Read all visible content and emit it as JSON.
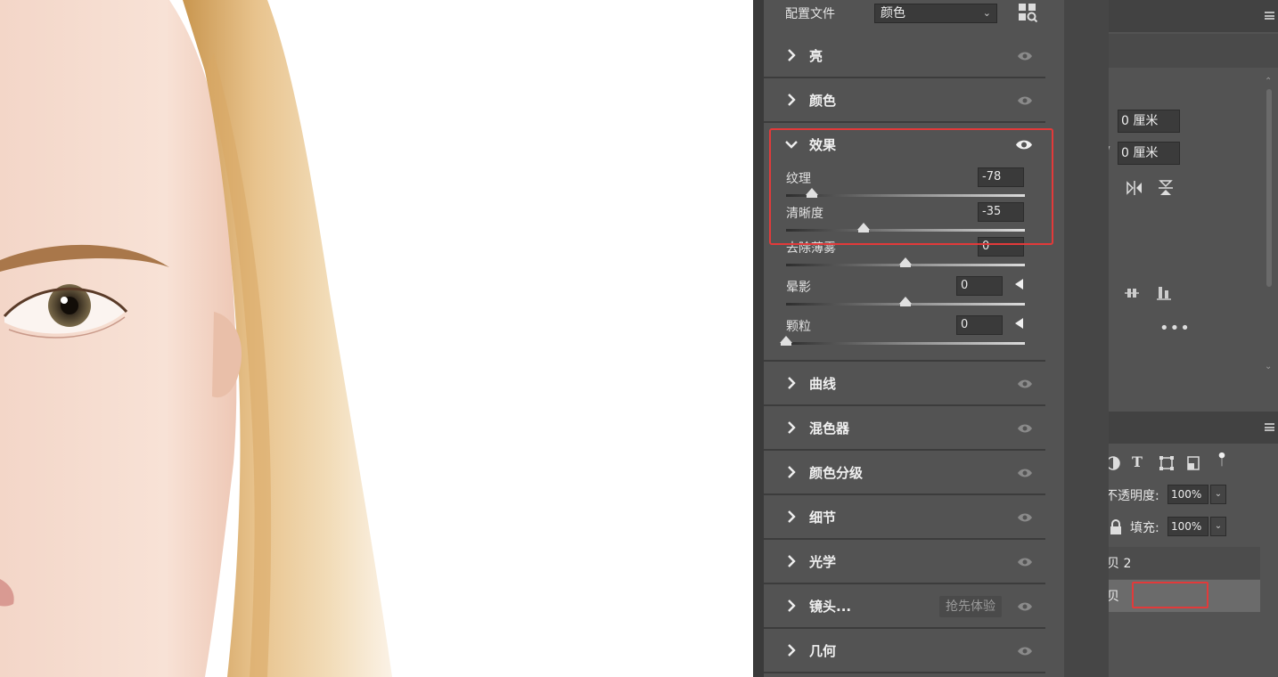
{
  "profile": {
    "label": "配置文件",
    "value": "颜色"
  },
  "sections_top": [
    {
      "title": "亮"
    },
    {
      "title": "颜色"
    }
  ],
  "effects": {
    "title": "效果",
    "sliders": [
      {
        "label": "纹理",
        "value": "-78",
        "position": 0.11
      },
      {
        "label": "清晰度",
        "value": "-35",
        "position": 0.325
      },
      {
        "label": "去除薄雾",
        "value": "0",
        "position": 0.5
      },
      {
        "label": "晕影",
        "value": "0",
        "position": 0.5
      },
      {
        "label": "颗粒",
        "value": "0",
        "position": 0.0
      }
    ]
  },
  "sections_bottom": [
    {
      "title": "曲线"
    },
    {
      "title": "混色器"
    },
    {
      "title": "颜色分级"
    },
    {
      "title": "细节"
    },
    {
      "title": "光学"
    },
    {
      "title": "镜头...",
      "badge": "抢先体验"
    },
    {
      "title": "几何"
    }
  ],
  "properties": {
    "x_value": "0 厘米",
    "y_value": "0 厘米"
  },
  "layers": {
    "opacity_label": "不透明度:",
    "opacity_value": "100%",
    "fill_label": "填充:",
    "fill_value": "100%",
    "layer_2_name": "贝 2",
    "layer_1_name": "贝"
  },
  "colors": {
    "highlight": "#e23a3a",
    "panel": "#535353"
  }
}
